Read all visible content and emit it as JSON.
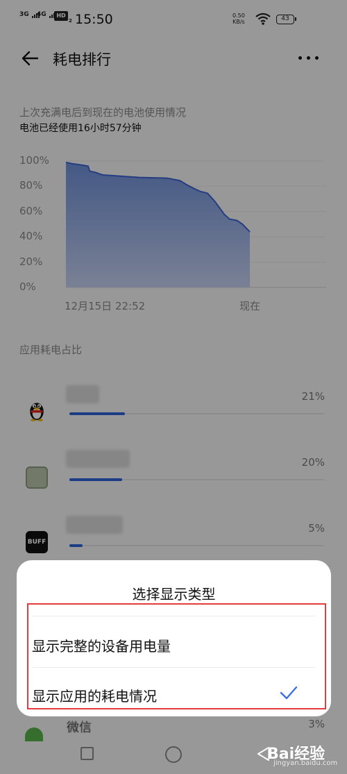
{
  "status_bar": {
    "network1": "3G",
    "network2": "4G",
    "hd_label": "HD",
    "hd_sub": "2",
    "time": "15:50",
    "speed_value": "0.50",
    "speed_unit": "KB/s",
    "battery": "43"
  },
  "header": {
    "title": "耗电排行"
  },
  "summary": {
    "line1": "上次充满电后到现在的电池使用情况",
    "line2": "电池已经使用16小时57分钟"
  },
  "chart_data": {
    "type": "area",
    "y_ticks": [
      "100%",
      "80%",
      "60%",
      "40%",
      "20%",
      "0%"
    ],
    "x_start_label": "12月15日 22:52",
    "x_end_label": "现在",
    "ylim": [
      0,
      100
    ],
    "x": [
      0,
      0.03,
      0.08,
      0.12,
      0.13,
      0.16,
      0.2,
      0.25,
      0.4,
      0.55,
      0.62,
      0.66,
      0.7,
      0.73,
      0.77,
      0.81,
      0.86,
      0.89,
      0.93,
      0.96,
      1.0
    ],
    "values": [
      99,
      98,
      97,
      96,
      92,
      91,
      89,
      88.5,
      87,
      86.5,
      84.5,
      81,
      78,
      76,
      74.5,
      68,
      58,
      54,
      53,
      50,
      44
    ],
    "line_color": "#3d63d0"
  },
  "usage_section": {
    "title": "应用耗电占比",
    "apps": [
      {
        "icon": "qq-penguin-icon",
        "percent": "21%",
        "fraction": 0.21
      },
      {
        "icon": "app-green-icon",
        "percent": "20%",
        "fraction": 0.2
      },
      {
        "icon": "buff-app-icon",
        "icon_text": "BUFF",
        "percent": "5%",
        "fraction": 0.05
      }
    ],
    "last_app_name": "微信",
    "last_app_percent": "3%"
  },
  "dialog": {
    "title": "选择显示类型",
    "options": [
      {
        "label": "显示完整的设备用电量",
        "selected": false
      },
      {
        "label": "显示应用的耗电情况",
        "selected": true
      }
    ],
    "check_color": "#3a6fe6",
    "highlight_color": "#e53b3b"
  },
  "watermark": {
    "brand": "Bai经验",
    "url": "jingyan.baidu.com"
  }
}
